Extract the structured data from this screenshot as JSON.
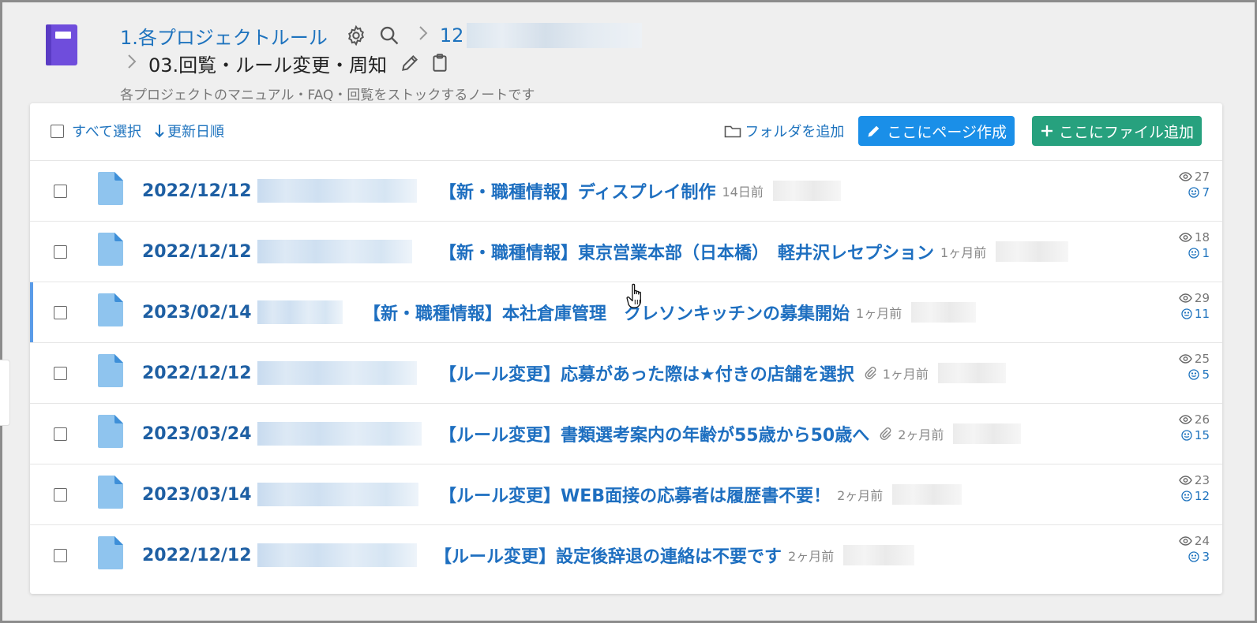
{
  "header": {
    "crumb1": "1.各プロジェクトルール",
    "crumb2_prefix": "12",
    "current": "03.回覧・ルール変更・周知",
    "subtitle": "各プロジェクトのマニュアル・FAQ・回覧をストックするノートです"
  },
  "toolbar": {
    "select_all": "すべて選択",
    "sort": "更新日順",
    "add_folder": "フォルダを追加",
    "create_page": "ここにページ作成",
    "add_file": "ここにファイル追加"
  },
  "colors": {
    "link": "#1e73be",
    "blue_button": "#1a8fe8",
    "green_button": "#27a17e",
    "note_icon": "#6f4ddc",
    "file_icon": "#8fc4ee"
  },
  "rows": [
    {
      "date": "2022/12/12",
      "title": "【新・職種情報】ディスプレイ制作",
      "ago": "14日前",
      "views": "27",
      "reactions": "7"
    },
    {
      "date": "2022/12/12",
      "title": "【新・職種情報】東京営業本部（日本橋）　軽井沢レセプション",
      "ago": "1ヶ月前",
      "views": "18",
      "reactions": "1"
    },
    {
      "date": "2023/02/14",
      "title": "【新・職種情報】本社倉庫管理　クレソンキッチンの募集開始",
      "ago": "1ヶ月前",
      "views": "29",
      "reactions": "11"
    },
    {
      "date": "2022/12/12",
      "title": "【ルール変更】応募があった際は★付きの店舗を選択",
      "ago": "1ヶ月前",
      "views": "25",
      "reactions": "5"
    },
    {
      "date": "2023/03/24",
      "title": "【ルール変更】書類選考案内の年齢が55歳から50歳へ",
      "ago": "2ヶ月前",
      "views": "26",
      "reactions": "15"
    },
    {
      "date": "2023/03/14",
      "title": "【ルール変更】WEB面接の応募者は履歴書不要！",
      "ago": "2ヶ月前",
      "views": "23",
      "reactions": "12"
    },
    {
      "date": "2022/12/12",
      "title": "【ルール変更】設定後辞退の連絡は不要です",
      "ago": "2ヶ月前",
      "views": "24",
      "reactions": "3"
    }
  ]
}
